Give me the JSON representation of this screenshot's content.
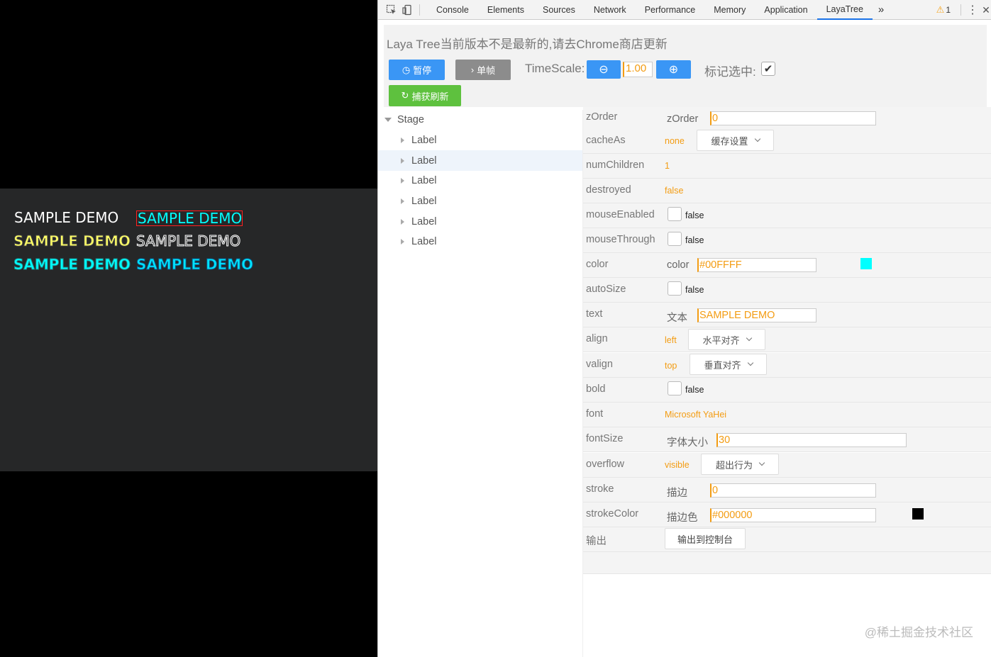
{
  "game": {
    "texts": [
      "SAMPLE DEMO",
      "SAMPLE DEMO",
      "SAMPLE DEMO",
      "SAMPLE DEMO",
      "SAMPLE DEMO",
      "SAMPLE DEMO"
    ]
  },
  "devtools": {
    "tabs": [
      "Console",
      "Elements",
      "Sources",
      "Network",
      "Performance",
      "Memory",
      "Application",
      "LayaTree"
    ],
    "more": "»",
    "warnings": "1",
    "warn_icon": "⚠",
    "kebab": "⋮",
    "close": "✕"
  },
  "panel": {
    "notice": "Laya Tree当前版本不是最新的,请去Chrome商店更新",
    "pause_icon": "◷",
    "pause_label": "暂停",
    "step_icon": "›",
    "step_label": "单帧",
    "capture_icon": "↻",
    "capture_label": "捕获刷新",
    "timescale_label": "TimeScale:",
    "minus_icon": "⊖",
    "timescale_value": "1.00",
    "plus_icon": "⊕",
    "mark_label": "标记选中:",
    "mark_checked": "✔"
  },
  "tree": {
    "root": "Stage",
    "children": [
      "Label",
      "Label",
      "Label",
      "Label",
      "Label",
      "Label"
    ]
  },
  "props": {
    "zOrder": {
      "name": "zOrder",
      "sub": "zOrder",
      "value": "0"
    },
    "cacheAs": {
      "name": "cacheAs",
      "value": "none",
      "select": "缓存设置"
    },
    "numChildren": {
      "name": "numChildren",
      "value": "1"
    },
    "destroyed": {
      "name": "destroyed",
      "value": "false"
    },
    "mouseEnabled": {
      "name": "mouseEnabled",
      "value": "false"
    },
    "mouseThrough": {
      "name": "mouseThrough",
      "value": "false"
    },
    "color": {
      "name": "color",
      "sub": "color",
      "value": "#00FFFF",
      "swatch": "#00FFFF"
    },
    "autoSize": {
      "name": "autoSize",
      "value": "false"
    },
    "text": {
      "name": "text",
      "sub": "文本",
      "value": "SAMPLE DEMO"
    },
    "align": {
      "name": "align",
      "value": "left",
      "select": "水平对齐"
    },
    "valign": {
      "name": "valign",
      "value": "top",
      "select": "垂直对齐"
    },
    "bold": {
      "name": "bold",
      "value": "false"
    },
    "font": {
      "name": "font",
      "value": "Microsoft YaHei"
    },
    "fontSize": {
      "name": "fontSize",
      "sub": "字体大小",
      "value": "30"
    },
    "overflow": {
      "name": "overflow",
      "value": "visible",
      "select": "超出行为"
    },
    "stroke": {
      "name": "stroke",
      "sub": "描边",
      "value": "0"
    },
    "strokeColor": {
      "name": "strokeColor",
      "sub": "描边色",
      "value": "#000000",
      "swatch": "#000000"
    },
    "output": {
      "name": "输出",
      "button": "输出到控制台"
    }
  },
  "watermark": "@稀土掘金技术社区"
}
